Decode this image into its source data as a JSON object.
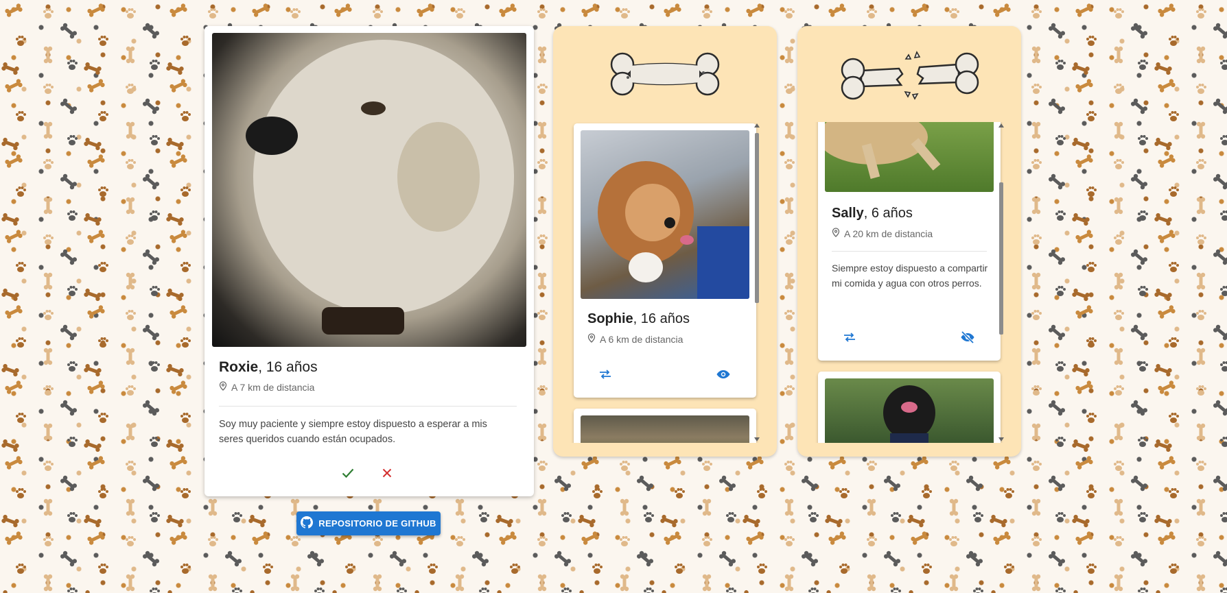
{
  "main_card": {
    "name": "Roxie",
    "age": ", 16 años",
    "distance": "A 7 km de distancia",
    "description": "Soy muy paciente y siempre estoy dispuesto a esperar a mis seres queridos cuando están ocupados."
  },
  "github_button": {
    "label": "REPOSITORIO DE GITHUB"
  },
  "liked_column": {
    "icon": "bone-icon",
    "cards": [
      {
        "name": "Sophie",
        "age": ", 16 años",
        "distance": "A 6 km de distancia"
      }
    ]
  },
  "rejected_column": {
    "icon": "broken-bone-icon",
    "cards": [
      {
        "name": "Sally",
        "age": ", 6 años",
        "distance": "A 20 km de distancia",
        "description": "Siempre estoy dispuesto a compartir mi comida y agua con otros perros."
      }
    ]
  },
  "colors": {
    "accept": "#2e7d32",
    "reject": "#d32f2f",
    "primary": "#1f77d2",
    "column_bg": "#fde4b6"
  }
}
